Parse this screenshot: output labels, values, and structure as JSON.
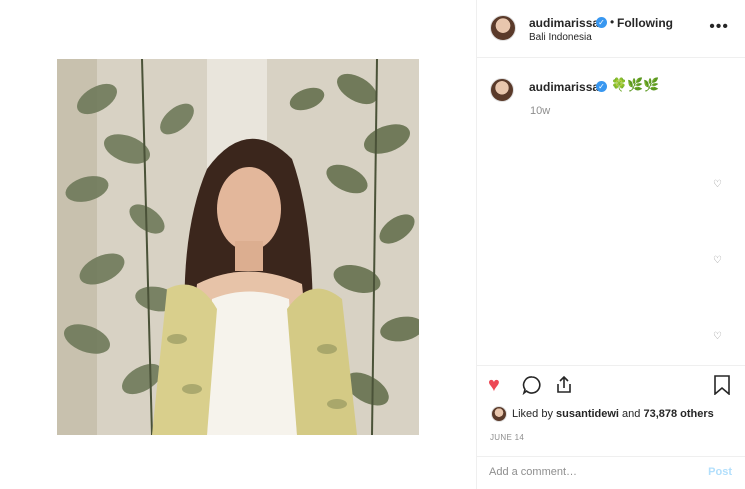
{
  "post": {
    "username": "audimarissa",
    "follow_separator": "•",
    "follow_status": "Following",
    "location": "Bali Indonesia",
    "more_icon": "more-horizontal-icon",
    "caption_emoji": "🍀🌿🌿",
    "post_age": "10w",
    "likes_prefix": "Liked by ",
    "liked_by_user": "susantidewi",
    "likes_middle": " and ",
    "likes_count": "73,878 others",
    "date": "JUNE 14",
    "comment_placeholder": "Add a comment…",
    "post_label": "Post"
  },
  "icons": {
    "verified": "verified-badge-icon",
    "heart": "heart-icon",
    "comment": "comment-icon",
    "share": "share-icon",
    "save": "bookmark-icon"
  },
  "colors": {
    "like_red": "#ed4956",
    "verified_blue": "#3897f0",
    "post_disabled": "#b2dffc",
    "muted_text": "#8e8e8e"
  }
}
